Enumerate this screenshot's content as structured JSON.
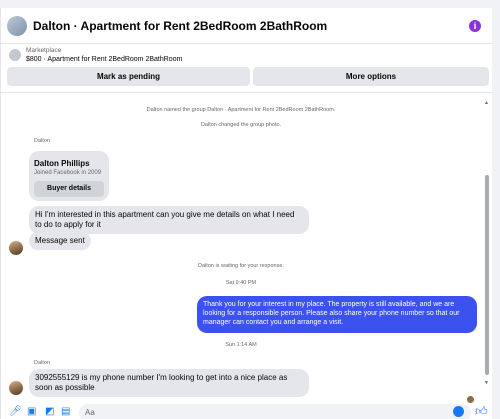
{
  "header": {
    "title": "Dalton · Apartment for Rent 2BedRoom 2BathRoom",
    "info_icon": "info-icon"
  },
  "listing": {
    "label": "Marketplace",
    "description": "$800 · Apartment for Rent 2BedRoom 2BathRoom"
  },
  "actions": {
    "pending": "Mark as pending",
    "more": "More options"
  },
  "thread": {
    "system_1": "Dalton named the group Dalton · Apartment for Rent 2BedRoom 2BathRoom.",
    "system_2": "Dalton changed the group photo.",
    "sender_1": "Dalton",
    "card": {
      "name": "Dalton Phillips",
      "joined": "Joined Facebook in 2009",
      "button": "Buyer details"
    },
    "msg_1": "Hi I'm interested in this apartment can you give me details on what I need to do to apply for it",
    "msg_2": "Message sent",
    "system_3": "Dalton is waiting for your response.",
    "time_1": "Sat 9:40 PM",
    "msg_out": "Thank you for your interest in my place. The property is still available, and we are looking for a responsible person. Please also share your phone number so that our manager can contact you and arrange a visit.",
    "time_2": "Sun 1:14 AM",
    "sender_2": "Dalton",
    "msg_3": "3092555129 is my phone number I'm looking to get into a nice place as soon as possible"
  },
  "composer": {
    "placeholder": "Aa"
  },
  "colors": {
    "accent": "#1877f2",
    "outgoing": "#3b52f0",
    "info": "#8a34d8"
  }
}
